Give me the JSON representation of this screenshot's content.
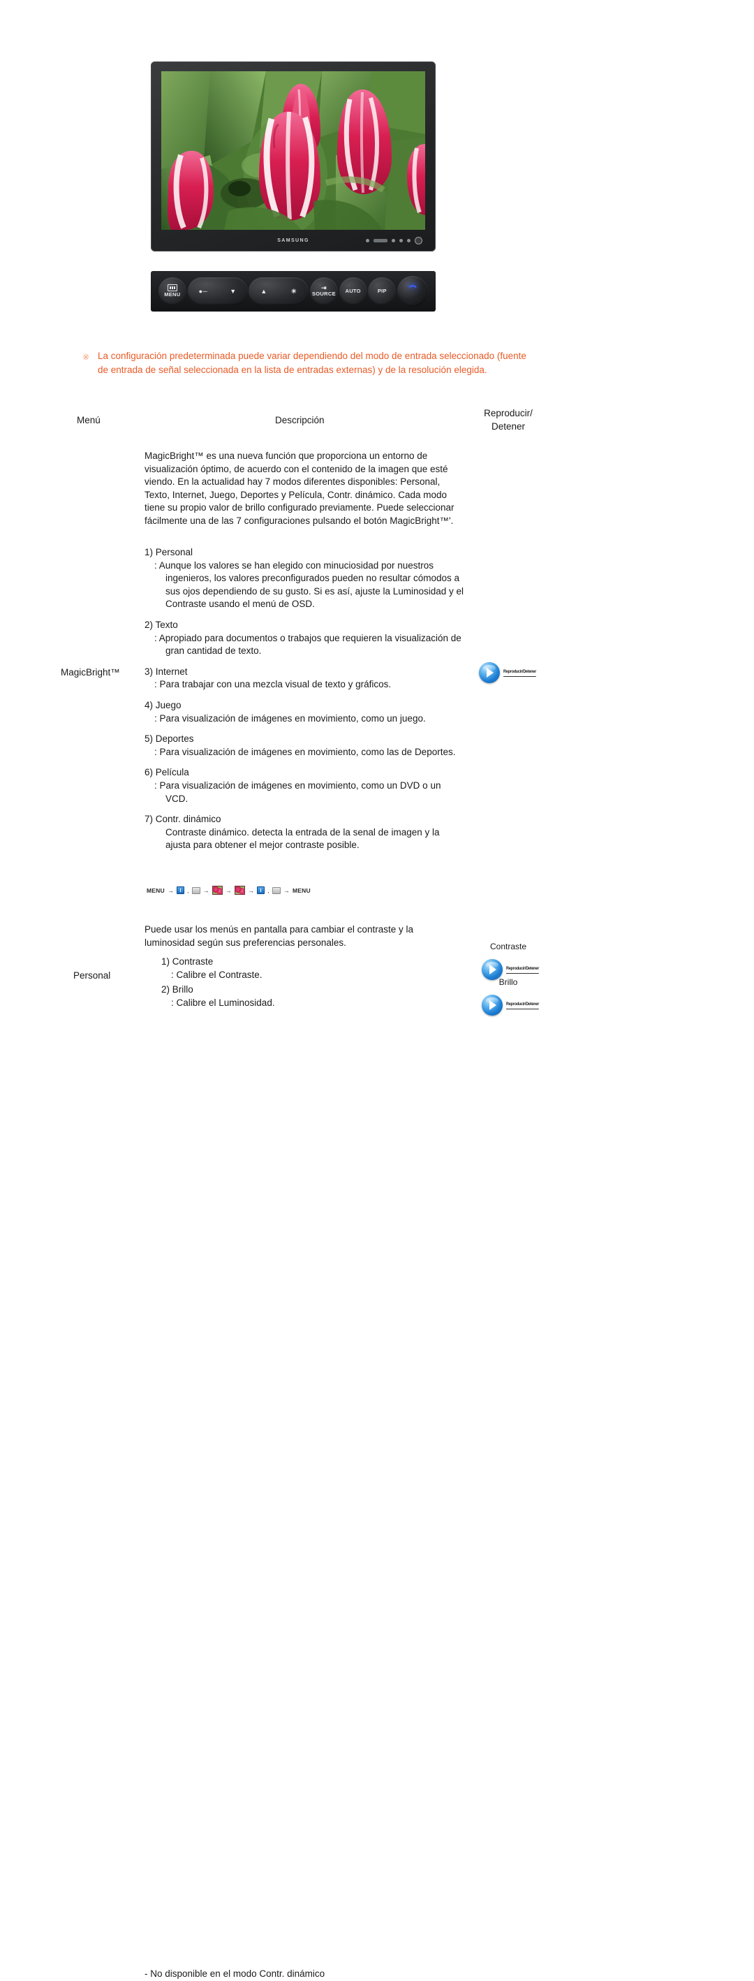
{
  "product": {
    "brand": "SAMSUNG",
    "monitor_alt": "tulips-wallpaper"
  },
  "control_buttons": [
    {
      "name": "menu-button",
      "label": "MENU",
      "glyph": "osd"
    },
    {
      "name": "updown-button",
      "label": "",
      "glyph": "arrows"
    },
    {
      "name": "brightness-button",
      "label": "",
      "glyph": "brightness"
    },
    {
      "name": "source-button",
      "label": "SOURCE",
      "glyph": "source"
    },
    {
      "name": "auto-button",
      "label": "AUTO",
      "glyph": "text"
    },
    {
      "name": "pip-button",
      "label": "PIP",
      "glyph": "text"
    },
    {
      "name": "power-button",
      "label": "",
      "glyph": "power"
    }
  ],
  "notice": {
    "marker": "※",
    "text": "La configuración predeterminada puede variar dependiendo del modo de entrada seleccionado (fuente de entrada de señal seleccionada en la lista de entradas externas) y de la resolución elegida."
  },
  "table": {
    "headers": {
      "menu": "Menú",
      "description": "Descripción",
      "play_stop": "Reproducir/ Detener"
    },
    "rows": [
      {
        "menu_label": "MagicBright™",
        "intro": "MagicBright™ es una nueva función que proporciona un entorno de visualización óptimo, de acuerdo con el contenido de la imagen que esté viendo. En la actualidad hay 7 modos diferentes disponibles: Personal, Texto, Internet, Juego, Deportes y Película, Contr. dinámico. Cada modo tiene su propio valor de brillo configurado previamente. Puede seleccionar fácilmente una de las 7 configuraciones pulsando el botón MagicBright™'.",
        "modes": [
          {
            "title": "1) Personal",
            "desc": ": Aunque los valores se han elegido con minuciosidad por nuestros ingenieros, los valores preconfigurados pueden no resultar cómodos a sus ojos dependiendo de su gusto. Si es así, ajuste la Luminosidad y el Contraste usando el menú de OSD."
          },
          {
            "title": "2) Texto",
            "desc": ": Apropiado para documentos o trabajos que requieren la visualización de gran cantidad de texto."
          },
          {
            "title": "3) Internet",
            "desc": ": Para trabajar con una mezcla visual de texto y gráficos."
          },
          {
            "title": "4) Juego",
            "desc": ": Para visualización de imágenes en movimiento, como un juego."
          },
          {
            "title": "5) Deportes",
            "desc": ": Para visualización de imágenes en movimiento, como las de Deportes."
          },
          {
            "title": "6) Película",
            "desc": ": Para visualización de imágenes en movimiento, como un DVD o un VCD."
          },
          {
            "title": "7) Contr. dinámico",
            "desc": "Contraste dinámico. detecta la entrada de la senal de imagen y la ajusta para obtener el mejor contraste posible."
          }
        ],
        "breadcrumb": {
          "start": "MENU",
          "end": "MENU",
          "arrow": "→",
          "comma": ",",
          "steps": [
            "blue-square-icon",
            "grey-bar-icon",
            "image-thumb-icon",
            "image-thumb-icon",
            "blue-square-icon",
            "grey-bar-icon"
          ]
        },
        "media": {
          "link_text": "Reproducir/Detener"
        }
      },
      {
        "menu_label": "Personal",
        "intro": "Puede usar los menús en pantalla para cambiar el contraste y la luminosidad según sus preferencias personales.",
        "items": [
          {
            "title": "1) Contraste",
            "desc": ": Calibre el Contraste."
          },
          {
            "title": "2) Brillo",
            "desc": ": Calibre el Luminosidad."
          }
        ],
        "note": "- No disponible en el modo Contr. dinámico",
        "media": [
          {
            "label": "Contraste",
            "link_text": "Reproducir/Detener"
          },
          {
            "label": "Brillo",
            "link_text": "Reproducir/Detener"
          }
        ]
      }
    ]
  },
  "colors": {
    "notice_text": "#E85A26",
    "notice_marker": "#F4A07A",
    "play_button": "#1E7FD4",
    "power_glow": "#3B5DE8"
  }
}
